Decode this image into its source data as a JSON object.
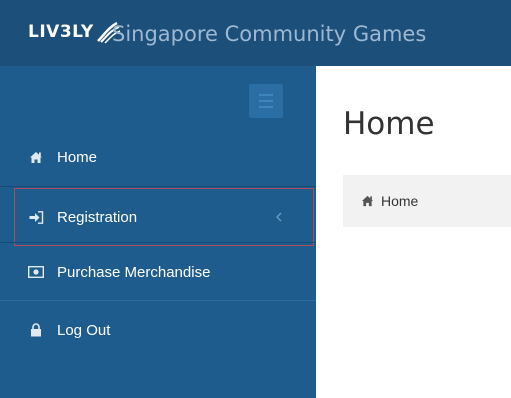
{
  "header": {
    "logo_text": "LIV3LY",
    "logo_icon": "runner-swoosh-icon",
    "title": "Singapore Community Games"
  },
  "sidebar": {
    "toggle_icon": "hamburger-icon",
    "items": [
      {
        "label": "Home",
        "icon": "home-icon"
      },
      {
        "label": "Registration",
        "icon": "sign-in-icon",
        "chevron": "chevron-left-icon"
      },
      {
        "label": "Purchase Merchandise",
        "icon": "money-icon"
      },
      {
        "label": "Log Out",
        "icon": "lock-icon"
      }
    ]
  },
  "main": {
    "page_title": "Home",
    "breadcrumb": {
      "label": "Home",
      "icon": "home-icon"
    }
  },
  "colors": {
    "header_bg": "#1c4f79",
    "sidebar_bg": "#1f5c8e",
    "title_text": "#9db8d2",
    "selected_outline": "#b14a5d",
    "breadcrumb_bg": "#f2f2f2"
  }
}
